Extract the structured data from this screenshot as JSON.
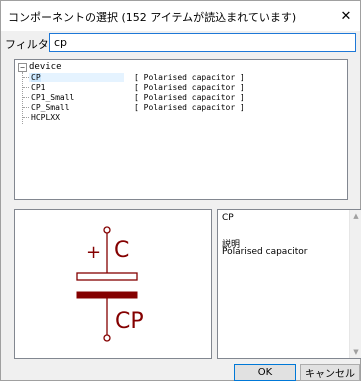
{
  "window": {
    "title": "コンポーネントの選択 (152 アイテムが読込まれています)",
    "close_label": "✕"
  },
  "filter": {
    "label": "フィルター:",
    "value": "cp"
  },
  "tree": {
    "root": {
      "expander": "−",
      "label": "device"
    },
    "items": [
      {
        "name": "CP",
        "description": "[ Polarised capacitor ]",
        "selected": true
      },
      {
        "name": "CP1",
        "description": "[ Polarised capacitor ]",
        "selected": false
      },
      {
        "name": "CP1_Small",
        "description": "[ Polarised capacitor ]",
        "selected": false
      },
      {
        "name": "CP_Small",
        "description": "[ Polarised capacitor ]",
        "selected": false
      },
      {
        "name": "HCPLXX",
        "description": "",
        "selected": false
      }
    ]
  },
  "preview": {
    "symbol": "polarised-capacitor",
    "reference_label": "C",
    "value_label": "CP",
    "polarity_mark": "+",
    "color": "#840000"
  },
  "info": {
    "name": "CP",
    "description_heading": "説明",
    "description": "Polarised capacitor"
  },
  "buttons": {
    "ok": "OK",
    "cancel": "キャンセル"
  },
  "colors": {
    "symbol": "#840000",
    "focus_border": "#1e78d7",
    "selection": "#cce8ff"
  }
}
